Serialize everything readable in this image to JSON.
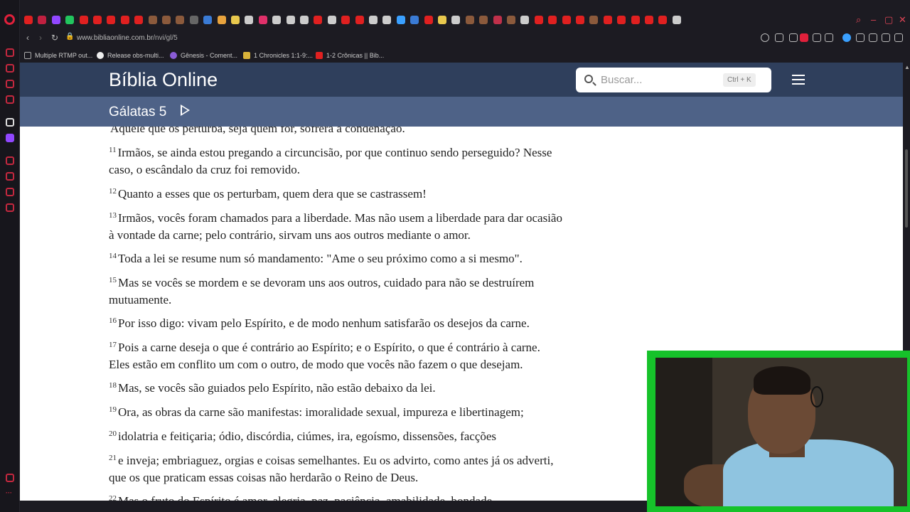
{
  "browser": {
    "url_host": "www.bibliaonline.com.br",
    "url_path": "/nvi/gl/5",
    "bookmarks": [
      {
        "label": "Multiple RTMP out..."
      },
      {
        "label": "Release obs-multi..."
      },
      {
        "label": "Gênesis - Coment..."
      },
      {
        "label": "1 Chronicles 1:1-9:..."
      },
      {
        "label": "1-2 Crônicas || Bib..."
      }
    ]
  },
  "site": {
    "title": "Bíblia Online",
    "search_placeholder": "Buscar...",
    "search_shortcut": "Ctrl + K"
  },
  "chapter": {
    "title": "Gálatas 5"
  },
  "verses": [
    {
      "num": "",
      "text": "Aquele que os perturba, seja quem for, sofrerá a condenação."
    },
    {
      "num": "11",
      "text": "Irmãos, se ainda estou pregando a circuncisão, por que continuo sendo perseguido? Nesse caso, o escândalo da cruz foi removido."
    },
    {
      "num": "12",
      "text": "Quanto a esses que os perturbam, quem dera que se castrassem!"
    },
    {
      "num": "13",
      "text": "Irmãos, vocês foram chamados para a liberdade. Mas não usem a liberdade para dar ocasião à vontade da carne; pelo contrário, sirvam uns aos outros mediante o amor."
    },
    {
      "num": "14",
      "text": "Toda a lei se resume num só mandamento: \"Ame o seu próximo como a si mesmo\"."
    },
    {
      "num": "15",
      "text": "Mas se vocês se mordem e se devoram uns aos outros, cuidado para não se destruírem mutuamente."
    },
    {
      "num": "16",
      "text": "Por isso digo: vivam pelo Espírito, e de modo nenhum satisfarão os desejos da carne."
    },
    {
      "num": "17",
      "text": "Pois a carne deseja o que é contrário ao Espírito; e o Espírito, o que é contrário à carne. Eles estão em conflito um com o outro, de modo que vocês não fazem o que desejam."
    },
    {
      "num": "18",
      "text": "Mas, se vocês são guiados pelo Espírito, não estão debaixo da lei."
    },
    {
      "num": "19",
      "text": "Ora, as obras da carne são manifestas: imoralidade sexual, impureza e libertinagem;"
    },
    {
      "num": "20",
      "text": "idolatria e feitiçaria; ódio, discórdia, ciúmes, ira, egoísmo, dissensões, facções"
    },
    {
      "num": "21",
      "text": "e inveja; embriaguez, orgias e coisas semelhantes. Eu os advirto, como antes já os adverti, que os que praticam essas coisas não herdarão o Reino de Deus."
    },
    {
      "num": "22",
      "text": "Mas o fruto do Espírito é amor, alegria, paz, paciência, amabilidade, bondade,"
    }
  ],
  "colors": {
    "header": "#2f3f5c",
    "chapter_bar": "#4e6287",
    "webcam_border": "#16c22a",
    "opera_red": "#e0203b"
  }
}
